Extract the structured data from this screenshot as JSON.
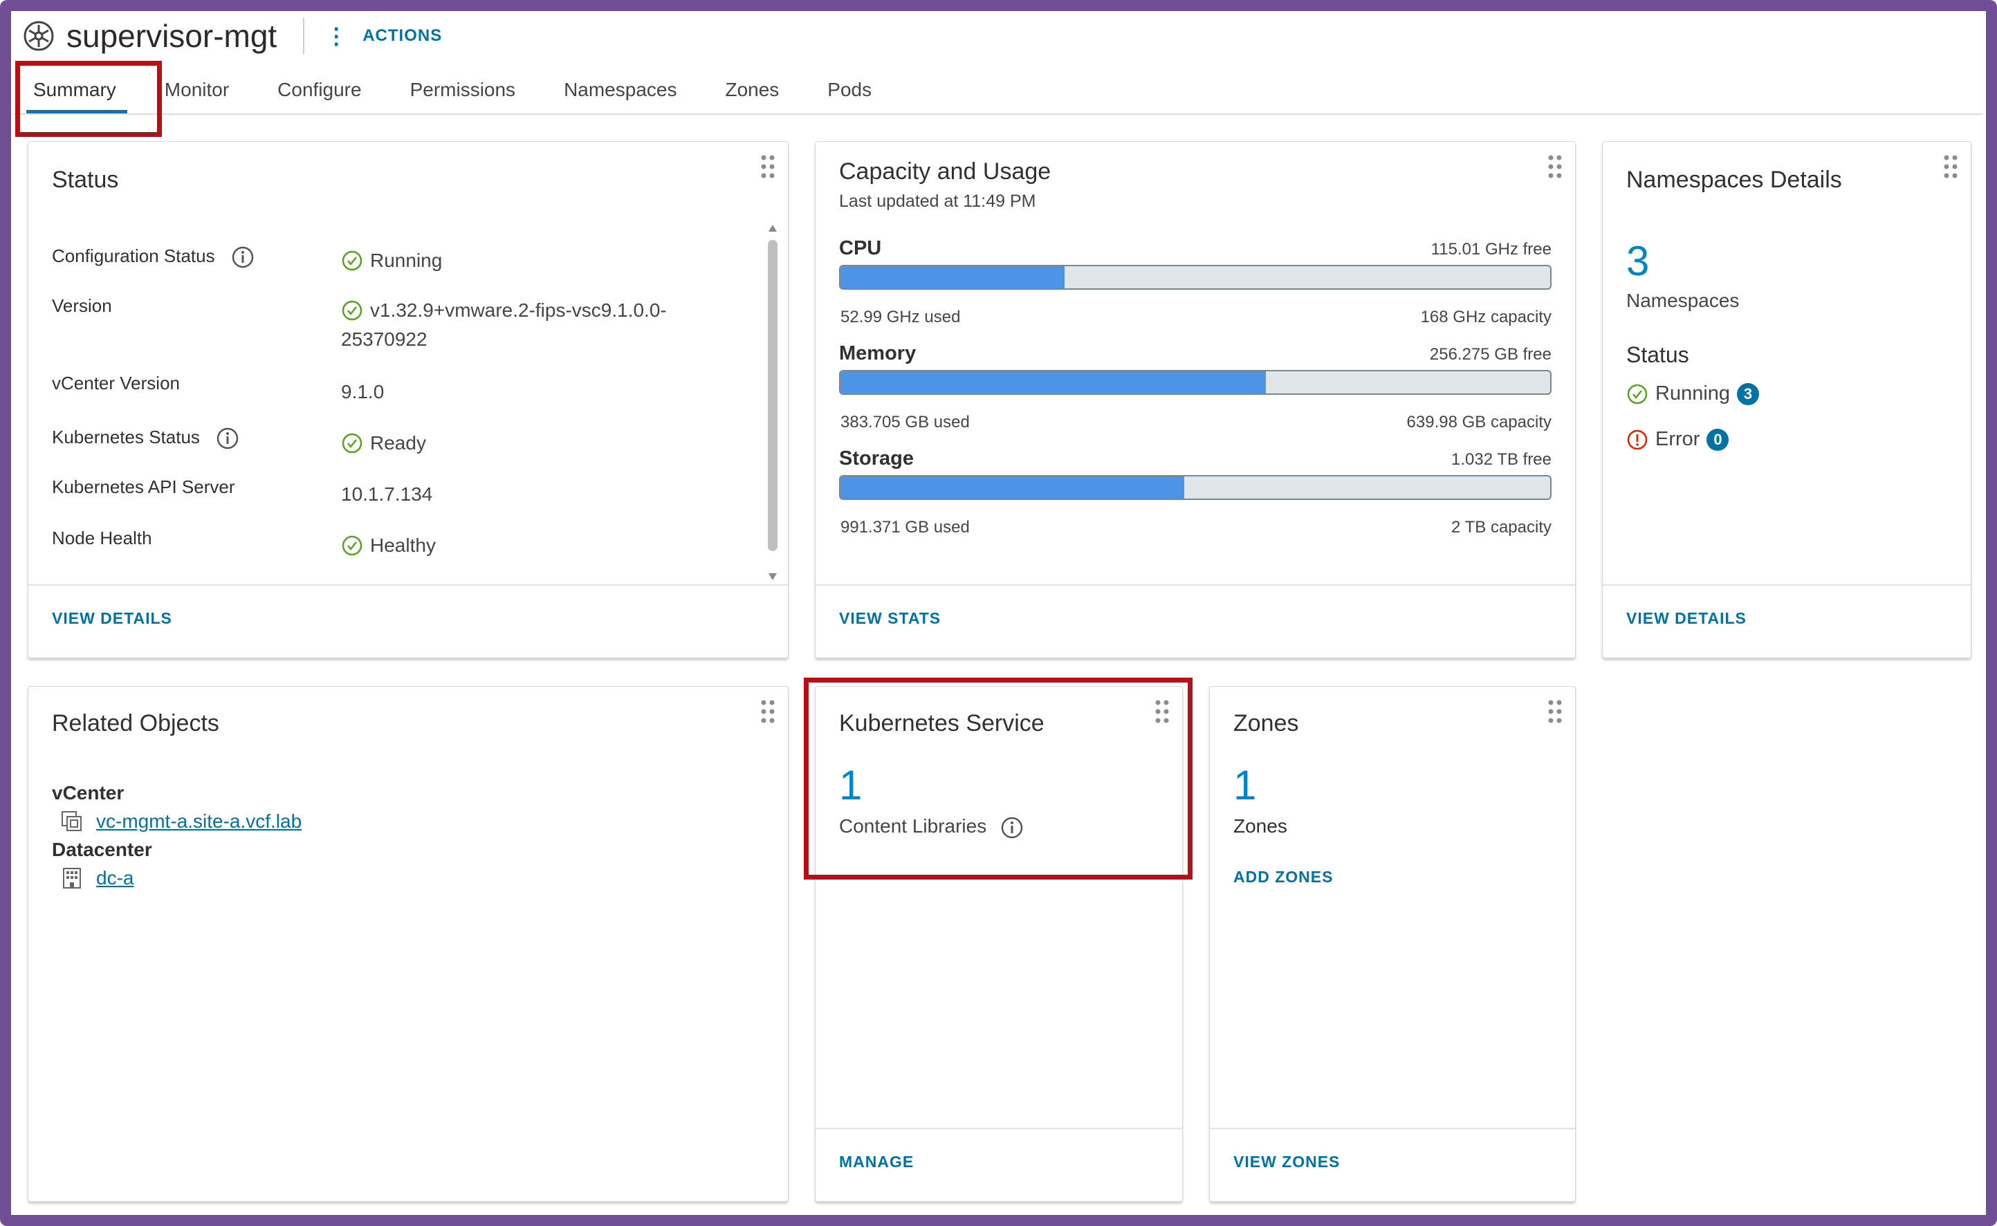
{
  "header": {
    "title": "supervisor-mgt",
    "actions_label": "ACTIONS"
  },
  "tabs": [
    {
      "label": "Summary"
    },
    {
      "label": "Monitor"
    },
    {
      "label": "Configure"
    },
    {
      "label": "Permissions"
    },
    {
      "label": "Namespaces"
    },
    {
      "label": "Zones"
    },
    {
      "label": "Pods"
    }
  ],
  "status_card": {
    "title": "Status",
    "rows": [
      {
        "label": "Configuration Status",
        "value": "Running"
      },
      {
        "label": "Version",
        "value": "v1.32.9+vmware.2-fips-vsc9.1.0.0-",
        "value2": "25370922"
      },
      {
        "label": "vCenter Version",
        "value": "9.1.0"
      },
      {
        "label": "Kubernetes Status",
        "value": "Ready"
      },
      {
        "label": "Kubernetes API Server",
        "value": "10.1.7.134"
      },
      {
        "label": "Node Health",
        "value": "Healthy"
      }
    ],
    "footer_link": "VIEW DETAILS"
  },
  "capacity_card": {
    "title": "Capacity and Usage",
    "updated": "Last updated at 11:49 PM",
    "resources": [
      {
        "name": "CPU",
        "free": "115.01 GHz free",
        "used": "52.99 GHz used",
        "capacity": "168 GHz capacity",
        "fraction": 0.3154
      },
      {
        "name": "Memory",
        "free": "256.275 GB free",
        "used": "383.705 GB used",
        "capacity": "639.98 GB capacity",
        "fraction": 0.5996
      },
      {
        "name": "Storage",
        "free": "1.032 TB free",
        "used": "991.371 GB used",
        "capacity": "2 TB capacity",
        "fraction": 0.484
      }
    ],
    "footer_link": "VIEW STATS"
  },
  "namespaces_card": {
    "title": "Namespaces Details",
    "count": "3",
    "count_label": "Namespaces",
    "status_heading": "Status",
    "running_label": "Running",
    "running_count": "3",
    "error_label": "Error",
    "error_count": "0",
    "footer_link": "VIEW DETAILS"
  },
  "related_card": {
    "title": "Related Objects",
    "vcenter_heading": "vCenter",
    "vcenter_link": "vc-mgmt-a.site-a.vcf.lab",
    "datacenter_heading": "Datacenter",
    "datacenter_link": "dc-a"
  },
  "k8s_service_card": {
    "title": "Kubernetes Service",
    "count": "1",
    "count_label": "Content Libraries",
    "footer_link": "MANAGE"
  },
  "zones_card": {
    "title": "Zones",
    "count": "1",
    "count_label": "Zones",
    "add_link": "ADD ZONES",
    "footer_link": "VIEW ZONES"
  },
  "colors": {
    "accent": "#0072a3",
    "bar_fill": "#4d94e9",
    "highlight": "#b60f17",
    "frame": "#6f4f96",
    "ok": "#5aa220",
    "error": "#e12200"
  },
  "icons": {
    "header": "kubernetes-icon",
    "info": "info-icon",
    "ok": "check-circle-icon",
    "error": "exclamation-circle-icon",
    "grip": "drag-handle-icon",
    "vcenter": "vcenter-icon",
    "datacenter": "datacenter-icon"
  }
}
